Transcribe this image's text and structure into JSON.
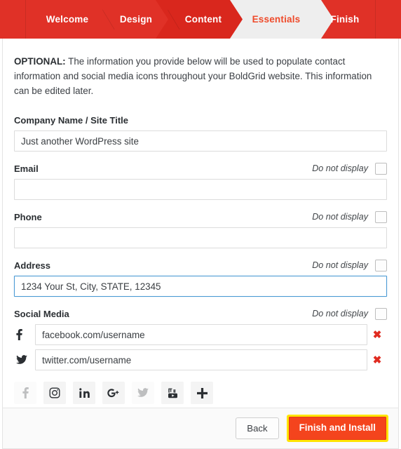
{
  "steps": [
    {
      "label": "Welcome",
      "state": "done"
    },
    {
      "label": "Design",
      "state": "done"
    },
    {
      "label": "Content",
      "state": "done"
    },
    {
      "label": "Essentials",
      "state": "active"
    },
    {
      "label": "Finish",
      "state": "upcoming"
    }
  ],
  "intro": {
    "lead": "OPTIONAL:",
    "text": " The information you provide below will be used to populate contact information and social media icons throughout your BoldGrid website. This information can be edited later."
  },
  "fields": {
    "company": {
      "label": "Company Name / Site Title",
      "value": "Just another WordPress site",
      "placeholder": ""
    },
    "email": {
      "label": "Email",
      "value": "",
      "placeholder": "",
      "donot_label": "Do not display",
      "donot_checked": false
    },
    "phone": {
      "label": "Phone",
      "value": "",
      "placeholder": "",
      "donot_label": "Do not display",
      "donot_checked": false
    },
    "address": {
      "label": "Address",
      "value": "1234 Your St, City, STATE, 12345",
      "placeholder": "",
      "donot_label": "Do not display",
      "donot_checked": false,
      "focused": true
    },
    "social": {
      "label": "Social Media",
      "donot_label": "Do not display",
      "donot_checked": false,
      "rows": [
        {
          "network": "facebook",
          "icon": "facebook-icon",
          "value": "facebook.com/username",
          "placeholder": ""
        },
        {
          "network": "twitter",
          "icon": "twitter-icon",
          "value": "twitter.com/username",
          "placeholder": ""
        }
      ],
      "picker": [
        {
          "icon": "facebook-icon",
          "name": "facebook",
          "disabled": true
        },
        {
          "icon": "instagram-icon",
          "name": "instagram",
          "disabled": false
        },
        {
          "icon": "linkedin-icon",
          "name": "linkedin",
          "disabled": false
        },
        {
          "icon": "googleplus-icon",
          "name": "googleplus",
          "disabled": false
        },
        {
          "icon": "twitter-icon",
          "name": "twitter",
          "disabled": true
        },
        {
          "icon": "youtube-icon",
          "name": "youtube",
          "disabled": false
        },
        {
          "icon": "plus-icon",
          "name": "add-more",
          "disabled": false
        }
      ]
    }
  },
  "footer": {
    "back_label": "Back",
    "finish_label": "Finish and Install"
  },
  "colors": {
    "brand_red": "#e03127",
    "active_orange": "#ef4a2a",
    "finish_button": "#f4441d",
    "highlight_ring": "#ffe400",
    "delete_x": "#e02b20",
    "focus_blue": "#4a9ad4"
  }
}
